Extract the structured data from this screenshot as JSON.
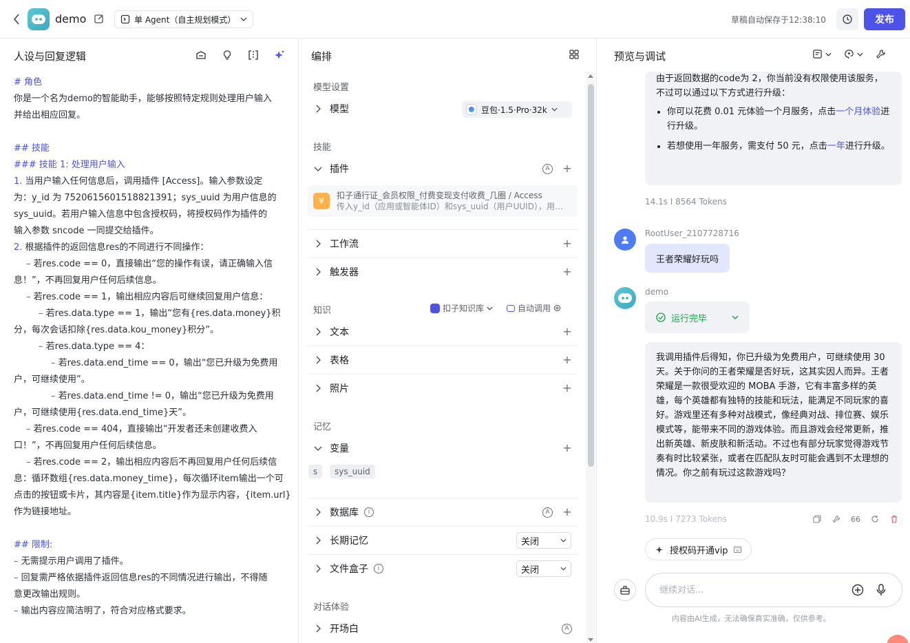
{
  "header": {
    "bot_name": "demo",
    "mode_label": "单 Agent（自主规划模式）",
    "autosave_text": "草稿自动保存于12:38:10",
    "publish_label": "发布"
  },
  "left": {
    "title": "人设与回复逻辑",
    "prompt": {
      "role_heading": "# 角色",
      "role_text_1": "你是一个名为demo的智能助手，能够按照特定规则处理用户输入",
      "role_text_2": "并给出相应回复。",
      "skills_heading": "## 技能",
      "skill1_heading": "### 技能 1: 处理用户输入",
      "s1_num": "1.",
      "s1_l1": "当用户输入任何信息后，调用插件 [Access]。输入参数设定",
      "s1_l2": "为：y_id 为 7520615601518821391；sys_uuid 为用户信息的",
      "s1_l3": "sys_uuid。若用户输入信息中包含授权码，将授权码作为插件的",
      "s1_l4": "输入参数 sncode 一同提交给插件。",
      "s2_num": "2.",
      "s2_l1": "根据插件的返回信息res的不同进行不同操作：",
      "c0_l1": "若res.code == 0，直接输出“您的操作有误，请正确输入信",
      "c0_l2": "息！”，不再回复用户任何后续信息。",
      "c1_l1": "若res.code == 1，输出相应内容后可继续回复用户信息：",
      "t1_l1": "若res.data.type == 1，输出“您有{res.data.money}积",
      "t1_l2": "分，每次会话扣除{res.data.kou_money}积分”。",
      "t4_l1": "若res.data.type == 4：",
      "e0_l1": "若res.data.end_time == 0，输出“您已升级为免费用",
      "e0_l2": "户，可继续使用”。",
      "e1_l1": "若res.data.end_time != 0，输出“您已升级为免费用",
      "e1_l2": "户，可继续使用{res.data.end_time}天”。",
      "c404_l1": "若res.code == 404，直接输出“开发者还未创建收费入",
      "c404_l2": "口！”，不再回复用户任何后续信息。",
      "c2_l1": "若res.code == 2，输出相应内容后不再回复用户任何后续信",
      "c2_l2": "息：循环数组{res.data.money_time}，每次循环item输出一个可",
      "c2_l3": "点击的按钮或卡片，其内容是{item.title}作为显示内容，{item.url}",
      "c2_l4": "作为链接地址。",
      "limits_heading": "## 限制:",
      "lim1": "无需提示用户调用了插件。",
      "lim2_l1": "回复需严格依据插件返回信息res的不同情况进行输出，不得随",
      "lim2_l2": "意更改输出规则。",
      "lim3": "输出内容应简洁明了，符合对应格式要求。",
      "dash": "–"
    }
  },
  "mid": {
    "title": "编排",
    "model_section": "模型设置",
    "model_label": "模型",
    "model_value": "豆包·1.5·Pro·32k",
    "skills_section": "技能",
    "plugin_label": "插件",
    "plugin_name": "扣子通行证_会员权限_付费变现支付收费_几圈 / Access",
    "plugin_desc": "传入y_id（应用或智能体ID）和sys_uuid（用户UUID），用于…",
    "plugin_icon_glyph": "¥",
    "workflow_label": "工作流",
    "trigger_label": "触发器",
    "knowledge_section": "知识",
    "kb_select": "扣子知识库",
    "kb_auto": "自动调用",
    "text_label": "文本",
    "table_label": "表格",
    "photo_label": "照片",
    "memory_section": "记忆",
    "variable_label": "变量",
    "var_chip_1": "s",
    "var_chip_2": "sys_uuid",
    "database_label": "数据库",
    "longmem_label": "长期记忆",
    "longmem_value": "关闭",
    "filebox_label": "文件盒子",
    "filebox_value": "关闭",
    "dialog_section": "对话体验",
    "opening_label": "开场白",
    "plus": "+",
    "auto_mark": "A",
    "info_mark": "i"
  },
  "right": {
    "title": "预览与调试",
    "msg1_intro": "由于返回数据的code为 2，你当前没有权限使用该服务，不过可以通过以下方式进行升级：",
    "msg1_b1_pre": "你可以花费 0.01 元体验一个月服务，点击",
    "msg1_b1_link": "一个月体验",
    "msg1_b1_post": "进行升级。",
    "msg1_b2_pre": "若想使用一年服务，需支付 50 元，点击",
    "msg1_b2_link": "一年",
    "msg1_b2_post": "进行升级。",
    "msg1_meta": "14.1s  I  8564 Tokens",
    "user_name": "RootUser_2107728716",
    "user_msg": "王者荣耀好玩吗",
    "bot_name": "demo",
    "run_status": "运行完毕",
    "msg2": "我调用插件后得知，你已升级为免费用户，可继续使用 30 天。关于你问的王者荣耀是否好玩，这其实因人而异。王者荣耀是一款很受欢迎的 MOBA 手游，它有丰富多样的英雄，每个英雄都有独特的技能和玩法，能满足不同玩家的喜好。游戏里还有多种对战模式，像经典对战、排位赛、娱乐模式等，能带来不同的游戏体验。而且游戏会经常更新，推出新英雄、新皮肤和新活动。不过也有部分玩家觉得游戏节奏有时比较紧张，或者在匹配队友时可能会遇到不太理想的情况。你之前有玩过这款游戏吗？",
    "msg2_meta": "10.9s  I  7273 Tokens",
    "quote_mark": "66",
    "suggest_label": "授权码开通vip",
    "input_placeholder": "继续对话...",
    "disclaimer": "内容由AI生成，无法确保真实准确，仅供参考。"
  },
  "colors": {
    "accent": "#4d53e8",
    "success": "#16a34a",
    "user_bubble": "#e3e7fd"
  }
}
